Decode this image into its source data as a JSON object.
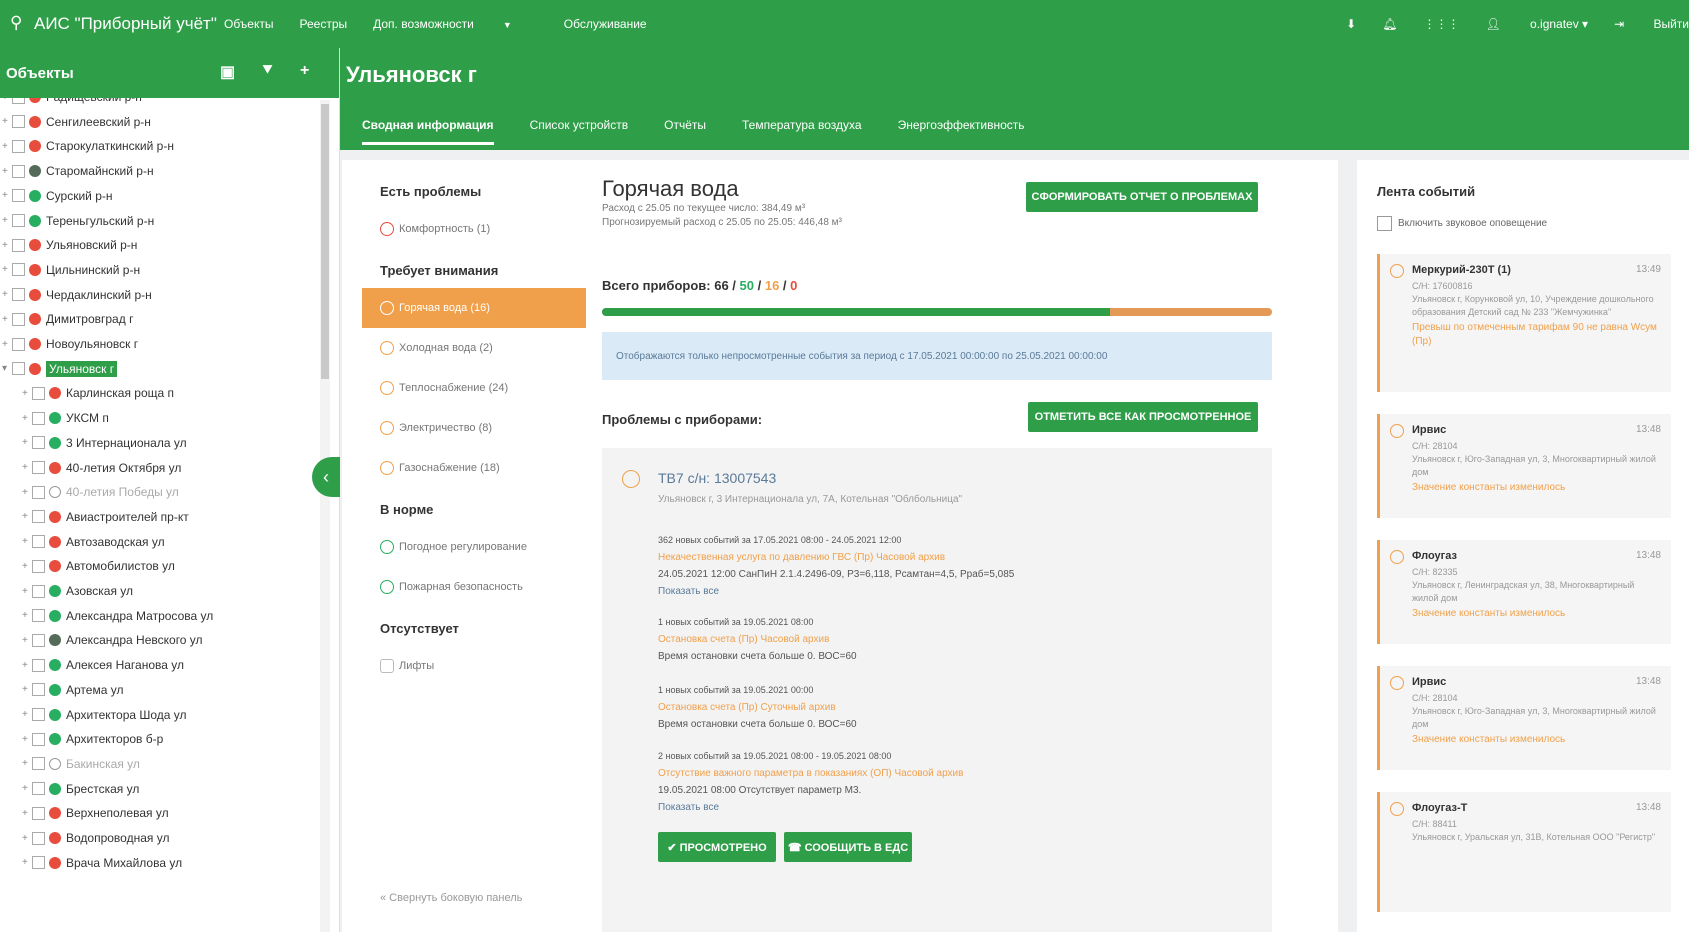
{
  "header": {
    "app_title": "АИС \"Приборный учёт\"",
    "nav": [
      "Объекты",
      "Реестры",
      "Доп. возможности",
      "Обслуживание"
    ],
    "user": "o.ignatev",
    "logout": "Выйти"
  },
  "sidebar": {
    "title": "Объекты",
    "tree": [
      {
        "label": "Радищевский р-н",
        "status": "red",
        "level": 0
      },
      {
        "label": "Сенгилеевский р-н",
        "status": "red",
        "level": 0
      },
      {
        "label": "Старокулаткинский р-н",
        "status": "red",
        "level": 0
      },
      {
        "label": "Старомайнский р-н",
        "status": "dark",
        "level": 0
      },
      {
        "label": "Сурский р-н",
        "status": "green",
        "level": 0
      },
      {
        "label": "Тереньгульский р-н",
        "status": "green",
        "level": 0
      },
      {
        "label": "Ульяновский р-н",
        "status": "red",
        "level": 0
      },
      {
        "label": "Цильнинский р-н",
        "status": "red",
        "level": 0
      },
      {
        "label": "Чердаклинский р-н",
        "status": "red",
        "level": 0
      },
      {
        "label": "Димитровград г",
        "status": "red",
        "level": 0
      },
      {
        "label": "Новоульяновск г",
        "status": "red",
        "level": 0
      },
      {
        "label": "Ульяновск г",
        "status": "red",
        "level": 0,
        "selected": true
      },
      {
        "label": "Карлинская роща п",
        "status": "red",
        "level": 1
      },
      {
        "label": "УКСМ п",
        "status": "green",
        "level": 1
      },
      {
        "label": "3 Интернационала ул",
        "status": "green",
        "level": 1
      },
      {
        "label": "40-летия Октября ул",
        "status": "red",
        "level": 1
      },
      {
        "label": "40-летия Победы ул",
        "status": "grey",
        "level": 1
      },
      {
        "label": "Авиастроителей пр-кт",
        "status": "red",
        "level": 1
      },
      {
        "label": "Автозаводская ул",
        "status": "red",
        "level": 1
      },
      {
        "label": "Автомобилистов ул",
        "status": "red",
        "level": 1
      },
      {
        "label": "Азовская ул",
        "status": "green",
        "level": 1
      },
      {
        "label": "Александра Матросова ул",
        "status": "green",
        "level": 1
      },
      {
        "label": "Александра Невского ул",
        "status": "dark",
        "level": 1
      },
      {
        "label": "Алексея Наганова ул",
        "status": "green",
        "level": 1
      },
      {
        "label": "Артема ул",
        "status": "green",
        "level": 1
      },
      {
        "label": "Архитектора Шода ул",
        "status": "green",
        "level": 1
      },
      {
        "label": "Архитекторов б-р",
        "status": "green",
        "level": 1
      },
      {
        "label": "Бакинская ул",
        "status": "grey",
        "level": 1
      },
      {
        "label": "Брестская ул",
        "status": "green",
        "level": 1
      },
      {
        "label": "Верхнеполевая ул",
        "status": "red",
        "level": 1
      },
      {
        "label": "Водопроводная ул",
        "status": "red",
        "level": 1
      },
      {
        "label": "Врача Михайлова ул",
        "status": "red",
        "level": 1
      }
    ]
  },
  "main": {
    "title": "Ульяновск г",
    "tabs": [
      "Сводная информация",
      "Список устройств",
      "Отчёты",
      "Температура воздуха",
      "Энергоэффективность"
    ]
  },
  "left_nav": {
    "groups": [
      {
        "heading": "Есть проблемы",
        "items": [
          {
            "label": "Комфортность (1)",
            "icon": "red"
          }
        ]
      },
      {
        "heading": "Требует внимания",
        "items": [
          {
            "label": "Горячая вода (16)",
            "icon": "white",
            "active": true
          },
          {
            "label": "Холодная вода (2)",
            "icon": "orange"
          },
          {
            "label": "Теплоснабжение (24)",
            "icon": "orange"
          },
          {
            "label": "Электричество (8)",
            "icon": "orange"
          },
          {
            "label": "Газоснабжение (18)",
            "icon": "orange"
          }
        ]
      },
      {
        "heading": "В норме",
        "items": [
          {
            "label": "Погодное регулирование",
            "icon": "green"
          },
          {
            "label": "Пожарная безопасность",
            "icon": "green"
          }
        ]
      },
      {
        "heading": "Отсутствует",
        "items": [
          {
            "label": "Лифты",
            "icon": "grey"
          }
        ]
      }
    ],
    "collapse": "« Свернуть боковую панель"
  },
  "content": {
    "title": "Горячая вода",
    "sub1": "Расход с 25.05 по текущее число: 384,49 м³",
    "sub2": "Прогнозируемый расход с 25.05 по 25.05: 446,48 м³",
    "report_button": "СФОРМИРОВАТЬ ОТЧЕТ О ПРОБЛЕМАХ",
    "total_label": "Всего приборов: 66 /",
    "total_ok": "50",
    "total_warn": "16",
    "total_err": "0",
    "ok_fraction": 0.7576,
    "info": "Отображаются только непросмотренные события за период с 17.05.2021 00:00:00 по 25.05.2021 00:00:00",
    "problems_heading": "Проблемы с приборами:",
    "mark_all_button": "ОТМЕТИТЬ ВСЕ КАК ПРОСМОТРЕННОЕ",
    "device": {
      "title": "ТВ7 с/н: 13007543",
      "address": "Ульяновск г, 3 Интернационала ул, 7А, Котельная \"Облбольница\"",
      "events": [
        {
          "head": "362 новых событий за 17.05.2021 08:00 - 24.05.2021 12:00",
          "type": "Некачественная услуга по давлению ГВС (Пр) Часовой архив",
          "text": "24.05.2021 12:00 СанПиН 2.1.4.2496-09, P3=6,118, Pсамтан=4,5, Pраб=5,085",
          "link": "Показать все"
        },
        {
          "head": "1 новых событий за 19.05.2021 08:00",
          "type": "Остановка счета (Пр) Часовой архив",
          "text": "Время остановки счета больше 0. ВОС=60",
          "link": ""
        },
        {
          "head": "1 новых событий за 19.05.2021 00:00",
          "type": "Остановка счета (Пр) Суточный архив",
          "text": "Время остановки счета больше 0. ВОС=60",
          "link": ""
        },
        {
          "head": "2 новых событий за 19.05.2021 08:00 - 19.05.2021 08:00",
          "type": "Отсутствие важного параметра в показаниях (ОП) Часовой архив",
          "text": "19.05.2021 08:00 Отсутствует параметр М3.",
          "link": "Показать все"
        }
      ],
      "viewed_button": "✔ ПРОСМОТРЕНО",
      "report_eds_button": "☎ СООБЩИТЬ В ЕДС"
    }
  },
  "feed": {
    "title": "Лента событий",
    "sound_toggle": "Включить звуковое оповещение",
    "items": [
      {
        "name": "Меркурий-230Т (1)",
        "time": "13:49",
        "sn": "С/Н: 17600816",
        "addr": "Ульяновск г, Корунковой ул, 10, Учреждение дошкольного образования Детский сад № 233 \"Жемчужинка\"",
        "event": "Превыш по отмеченным тарифам 90 не равна Wсум (Пр)"
      },
      {
        "name": "Ирвис",
        "time": "13:48",
        "sn": "С/Н: 28104",
        "addr": "Ульяновск г, Юго-Западная ул, 3, Многоквартирный жилой дом",
        "event": "Значение константы изменилось"
      },
      {
        "name": "Флоугаз",
        "time": "13:48",
        "sn": "С/Н: 82335",
        "addr": "Ульяновск г, Ленинградская ул, 38, Многоквартирный жилой дом",
        "event": "Значение константы изменилось"
      },
      {
        "name": "Ирвис",
        "time": "13:48",
        "sn": "С/Н: 28104",
        "addr": "Ульяновск г, Юго-Западная ул, 3, Многоквартирный жилой дом",
        "event": "Значение константы изменилось"
      },
      {
        "name": "Флоугаз-Т",
        "time": "13:48",
        "sn": "С/Н: 88411",
        "addr": "Ульяновск г, Уральская ул, 31В, Котельная ООО \"Регистр\"",
        "event": ""
      }
    ]
  }
}
